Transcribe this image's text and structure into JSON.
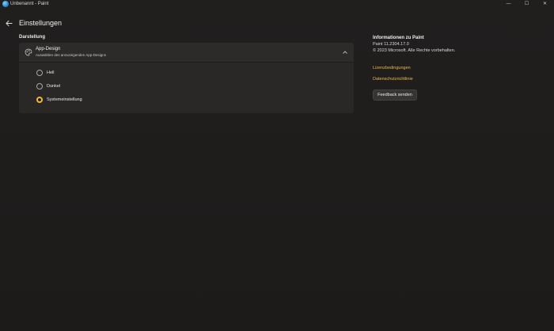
{
  "window": {
    "title": "Unbenannt - Paint",
    "controls": {
      "minimize": "—",
      "maximize": "☐",
      "close": "✕"
    }
  },
  "header": {
    "back_icon": "arrow-left-icon",
    "title": "Einstellungen"
  },
  "appearance": {
    "section_title": "Darstellung",
    "card": {
      "icon": "palette-icon",
      "label": "App-Design",
      "description": "Auswählen des anzuzeigenden App-Designs",
      "expanded": true,
      "options": [
        {
          "label": "Hell",
          "selected": false
        },
        {
          "label": "Dunkel",
          "selected": false
        },
        {
          "label": "Systemeinstellung",
          "selected": true
        }
      ]
    }
  },
  "about": {
    "title": "Informationen zu Paint",
    "version": "Paint 11.2304.17.0",
    "copyright": "© 2023 Microsoft. Alle Rechte vorbehalten.",
    "links": {
      "terms": "Lizenzbedingungen",
      "privacy": "Datenschutzrichtlinie"
    },
    "feedback_button": "Feedback senden"
  },
  "colors": {
    "accent": "#f0b93a",
    "link": "#e8b84a",
    "background": "#1e1c1b",
    "card": "#2a2827"
  }
}
